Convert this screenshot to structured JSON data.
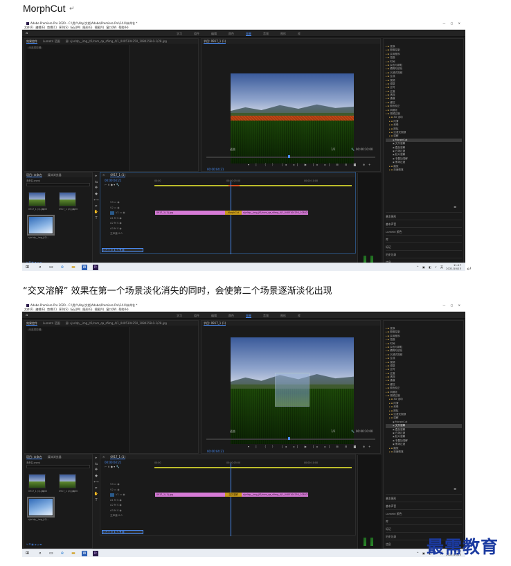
{
  "doc": {
    "heading": "MorphCut",
    "caption": "“交叉溶解” 效果在第一个场景淡化消失的同时，会使第二个场景逐渐淡化出现",
    "return_mark": "↵",
    "watermark": "最需教育"
  },
  "app": {
    "title": "Adobe Premiere Pro 2020 - C:\\用户\\Aby\\文档\\Adobe\\Premiere Pro\\14.0\\未命名 *",
    "menu": [
      "文件(F)",
      "编辑(E)",
      "剪辑(C)",
      "序列(S)",
      "标记(M)",
      "图形(G)",
      "视图(V)",
      "窗口(W)",
      "帮助(H)"
    ],
    "workspaces": [
      "学习",
      "组件",
      "编辑",
      "颜色",
      "效果",
      "音频",
      "图形",
      "库"
    ],
    "active_workspace": "效果",
    "source_tabs": [
      "效果控件",
      "Lumetri 范围",
      "源: sjvrldp__img_jt2/com_qa_sfimg_4/1_0405104250_1084258-0-1/28.jpg"
    ],
    "source_empty": "(未选择剪辑)",
    "program_tab": "节目: 0917_1 (1)",
    "program_timecode": "00:00:04:21",
    "program_fit": "适合",
    "program_quality": "1/2",
    "program_duration": "00:00:10:00",
    "project_tabs": [
      "项目: 未命名",
      "媒体浏览器"
    ],
    "project_file": "未命名.prproj",
    "project_items": [
      {
        "name": "0917_1 (1).jpg",
        "dur": "5:00"
      },
      {
        "name": "0917_1 (2).jpg",
        "dur": "5:00"
      },
      {
        "name": "sjvrldp__img_jt2/...",
        "dur": "5:00"
      }
    ],
    "sequence_tab": "0917_1 (1)",
    "sequence_timecode": "00:00:04:21",
    "ruler": [
      "00:00",
      "00:00:05:00",
      "00:00:10:00"
    ],
    "tracks": [
      "V3",
      "V2",
      "V1",
      "A1",
      "A2",
      "A3",
      "主声道"
    ],
    "master_value": "0.0",
    "clip_a": "0917_1 (1).jpg",
    "clip_b": "sjvrldp__img_jt2/com_qa_sfimg_4/1_0405104250_1084258",
    "effects": [
      {
        "label": "变换",
        "kind": "folder"
      },
      {
        "label": "图像控制",
        "kind": "folder"
      },
      {
        "label": "实用程序",
        "kind": "folder"
      },
      {
        "label": "扭曲",
        "kind": "folder"
      },
      {
        "label": "时间",
        "kind": "folder"
      },
      {
        "label": "杂色与颗粒",
        "kind": "folder"
      },
      {
        "label": "模糊与锐化",
        "kind": "folder"
      },
      {
        "label": "沉浸式视频",
        "kind": "folder"
      },
      {
        "label": "生成",
        "kind": "folder"
      },
      {
        "label": "视频",
        "kind": "folder"
      },
      {
        "label": "调整",
        "kind": "folder"
      },
      {
        "label": "过时",
        "kind": "folder"
      },
      {
        "label": "过渡",
        "kind": "folder"
      },
      {
        "label": "透视",
        "kind": "folder"
      },
      {
        "label": "通道",
        "kind": "folder"
      },
      {
        "label": "键控",
        "kind": "folder"
      },
      {
        "label": "颜色校正",
        "kind": "folder"
      },
      {
        "label": "风格化",
        "kind": "folder"
      },
      {
        "label": "视频过渡",
        "kind": "folder"
      },
      {
        "label": "3D 运动",
        "kind": "folder"
      },
      {
        "label": "内滑",
        "kind": "folder"
      },
      {
        "label": "划像",
        "kind": "folder"
      },
      {
        "label": "擦除",
        "kind": "folder"
      },
      {
        "label": "沉浸式视频",
        "kind": "folder"
      },
      {
        "label": "溶解",
        "kind": "folder"
      },
      {
        "label": "MorphCut",
        "kind": "file"
      },
      {
        "label": "交叉溶解",
        "kind": "file"
      },
      {
        "label": "叠加溶解",
        "kind": "file"
      },
      {
        "label": "白场过渡",
        "kind": "file"
      },
      {
        "label": "胶片溶解",
        "kind": "file"
      },
      {
        "label": "非叠加溶解",
        "kind": "file"
      },
      {
        "label": "黑场过渡",
        "kind": "file"
      },
      {
        "label": "缩放",
        "kind": "folder"
      },
      {
        "label": "页面剥落",
        "kind": "folder"
      }
    ],
    "right_panels": [
      "基本图形",
      "基本声音",
      "Lumetri 颜色",
      "库",
      "标记",
      "历史记录",
      "信息"
    ],
    "taskbar_time": "11:17",
    "taskbar_date": "2021/10/13"
  },
  "screens": [
    {
      "transition_label": "MorphCut",
      "selected_effect": "MorphCut"
    },
    {
      "transition_label": "交叉溶解",
      "selected_effect": "交叉溶解"
    }
  ]
}
